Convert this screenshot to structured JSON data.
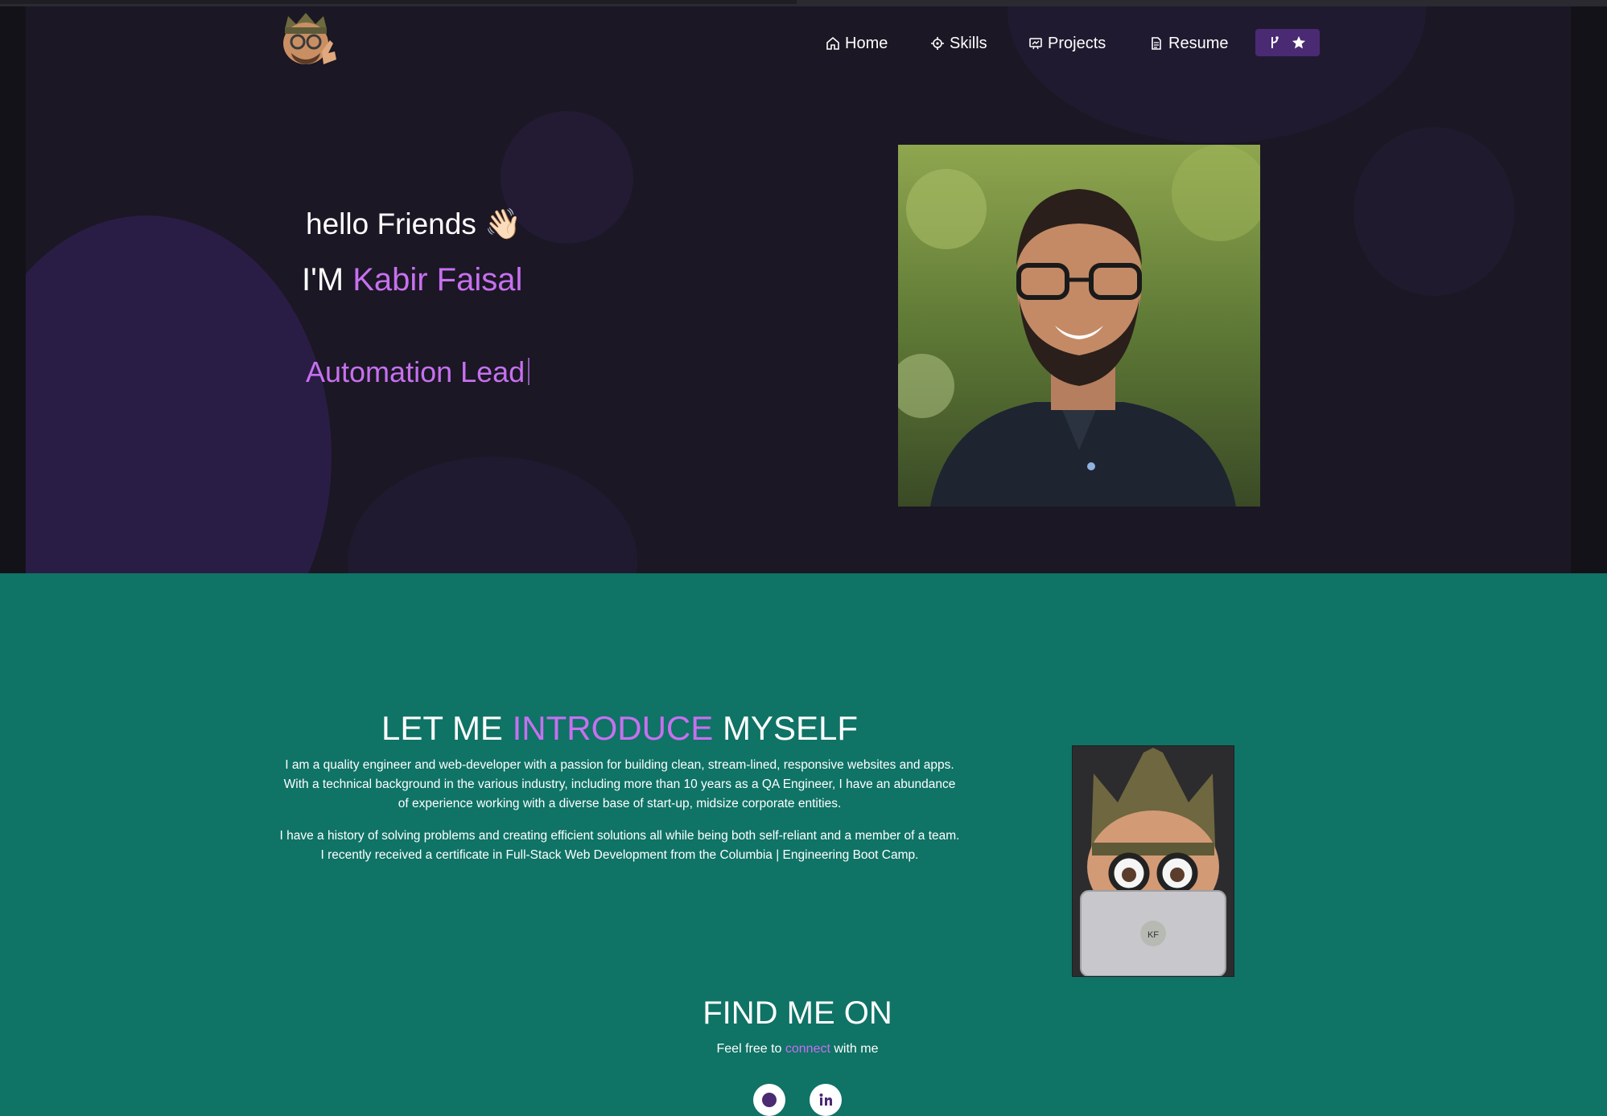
{
  "nav": {
    "home_label": "Home",
    "skills_label": "Skills",
    "projects_label": "Projects",
    "resume_label": "Resume"
  },
  "hero": {
    "greeting": "hello Friends",
    "wave_emoji": "👋🏻",
    "im_prefix": "I'M ",
    "name": "Kabir Faisal",
    "role": "Automation Lead"
  },
  "intro": {
    "title_part1": "LET ME ",
    "title_highlight": "INTRODUCE",
    "title_part2": " MYSELF",
    "paragraph1": "I am a quality engineer and web-developer with a passion for building clean, stream-lined, responsive websites and apps. With a technical background in the various industry, including more than 10 years as a QA Engineer, I have an abundance of experience working with a diverse base of start-up, midsize corporate entities.",
    "paragraph2": "I have a history of solving problems and creating efficient solutions all while being both self-reliant and a member of a team. I recently received a certificate in Full-Stack Web Development from the Columbia | Engineering Boot Camp.",
    "laptop_initials": "KF"
  },
  "find": {
    "title": "FIND ME ON",
    "sub_prefix": "Feel free to ",
    "sub_highlight": "connect",
    "sub_suffix": " with me"
  },
  "colors": {
    "accent": "#c770f0",
    "teal_background": "#0f7366",
    "hero_background": "#1b1724",
    "star_button": "#4a2a73"
  },
  "icons": [
    "home-icon",
    "skills-icon",
    "projects-icon",
    "resume-icon",
    "fork-icon",
    "star-icon",
    "github-icon",
    "linkedin-icon"
  ]
}
